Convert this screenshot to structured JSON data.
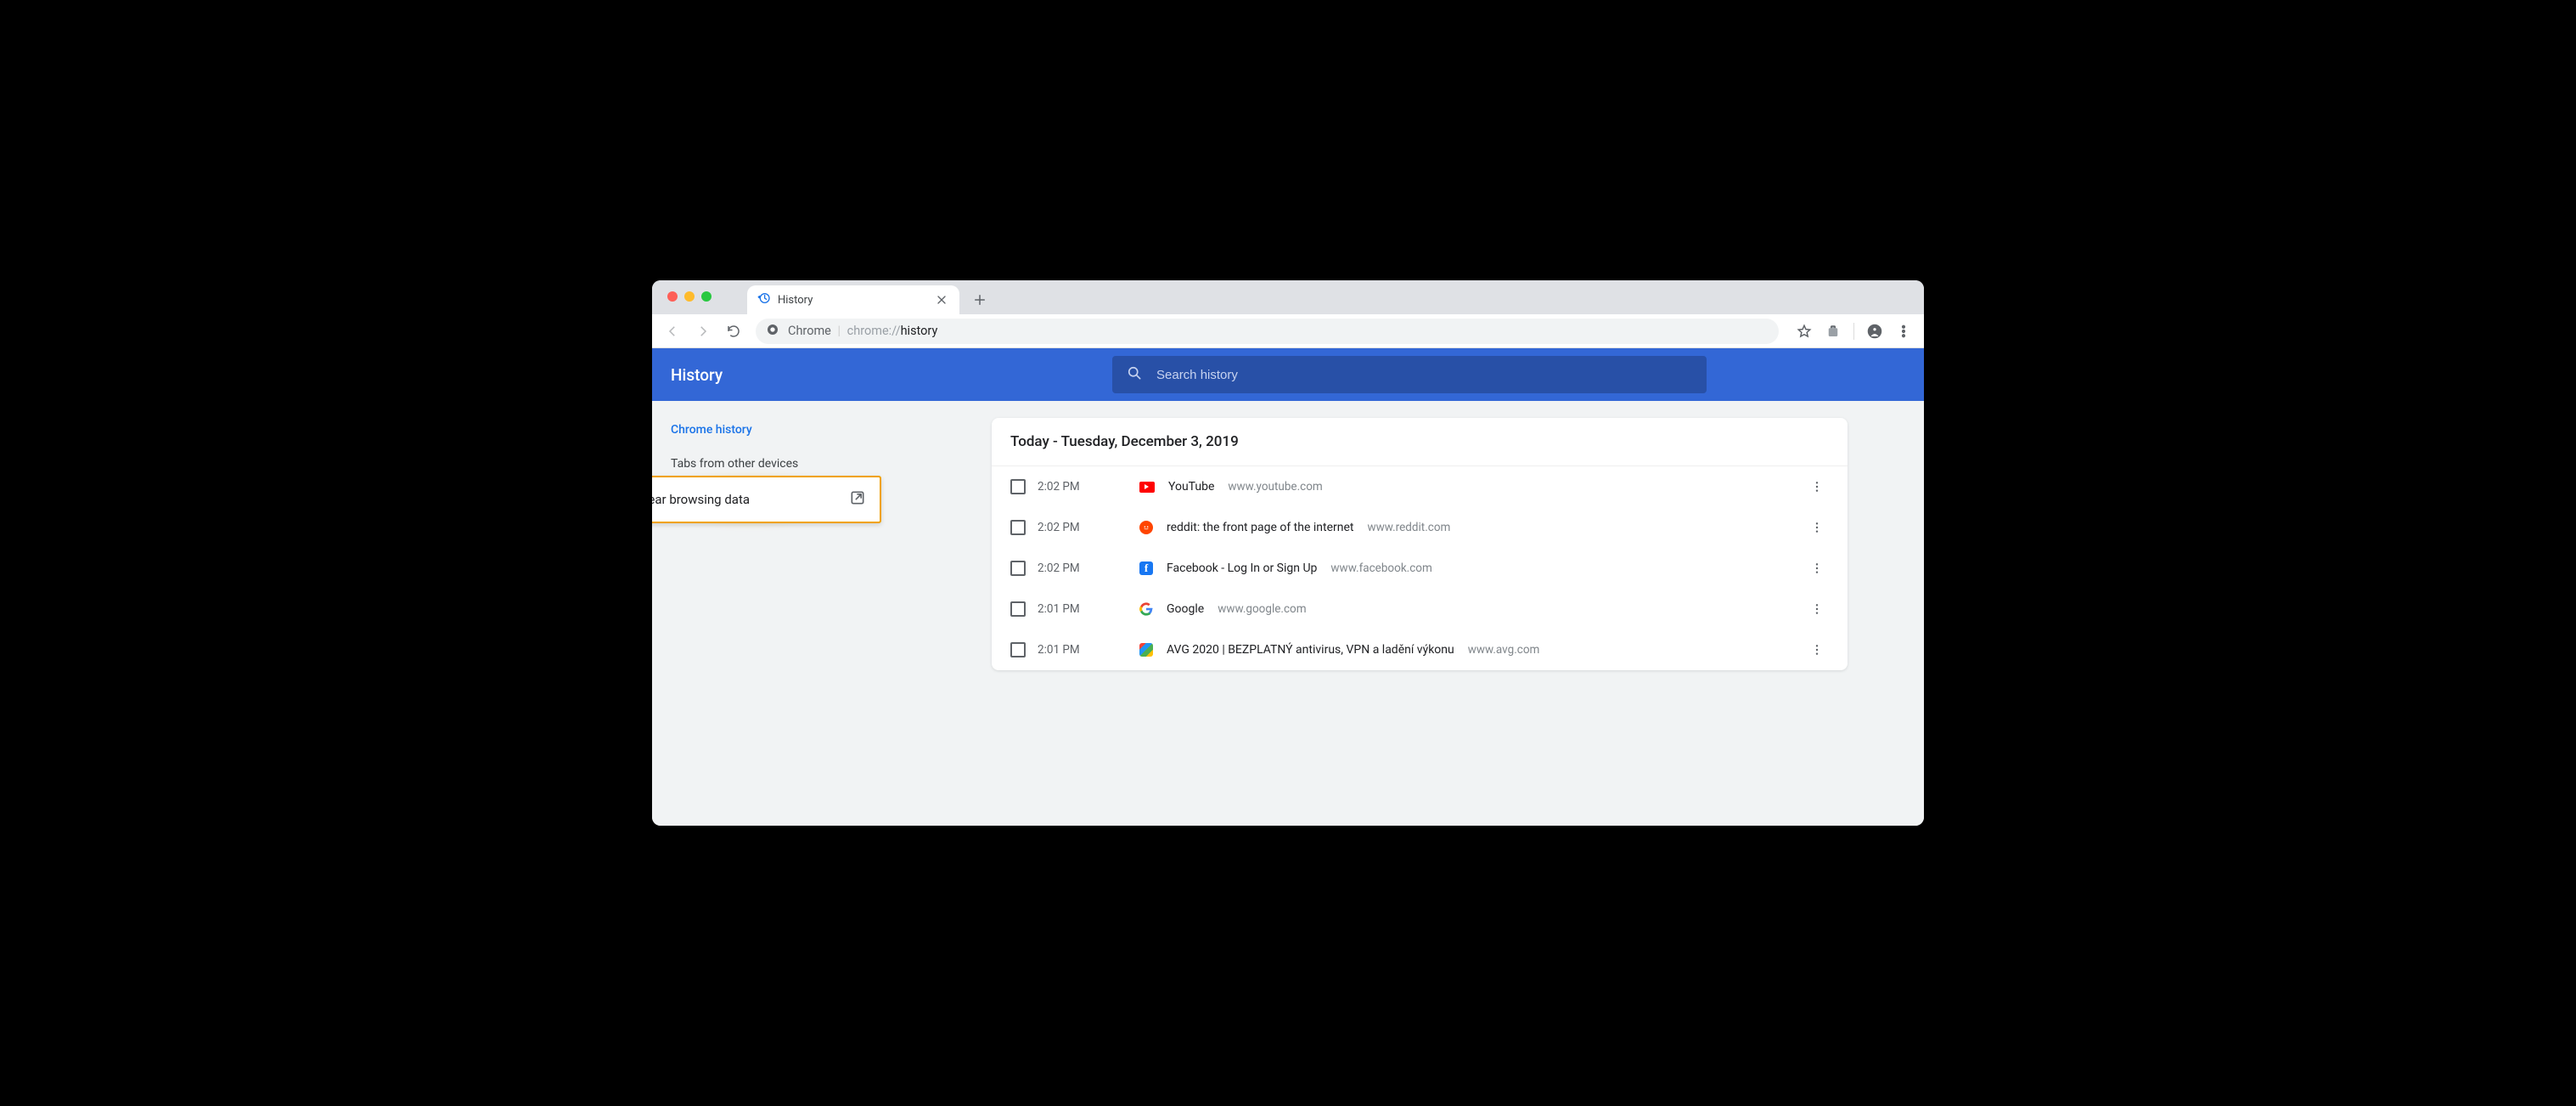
{
  "window": {
    "tab_title": "History",
    "address_label": "Chrome",
    "address_prefix": "chrome://",
    "address_path": "history"
  },
  "app": {
    "title": "History",
    "search_placeholder": "Search history"
  },
  "sidebar": {
    "items": [
      {
        "label": "Chrome history"
      },
      {
        "label": "Tabs from other devices"
      }
    ],
    "clear_label": "Clear browsing data"
  },
  "card": {
    "header": "Today - Tuesday, December 3, 2019",
    "rows": [
      {
        "time": "2:02 PM",
        "title": "YouTube",
        "url": "www.youtube.com",
        "icon": "youtube"
      },
      {
        "time": "2:02 PM",
        "title": "reddit: the front page of the internet",
        "url": "www.reddit.com",
        "icon": "reddit"
      },
      {
        "time": "2:02 PM",
        "title": "Facebook - Log In or Sign Up",
        "url": "www.facebook.com",
        "icon": "facebook"
      },
      {
        "time": "2:01 PM",
        "title": "Google",
        "url": "www.google.com",
        "icon": "google"
      },
      {
        "time": "2:01 PM",
        "title": "AVG 2020 | BEZPLATNÝ antivirus, VPN a ladění výkonu",
        "url": "www.avg.com",
        "icon": "avg"
      }
    ]
  }
}
